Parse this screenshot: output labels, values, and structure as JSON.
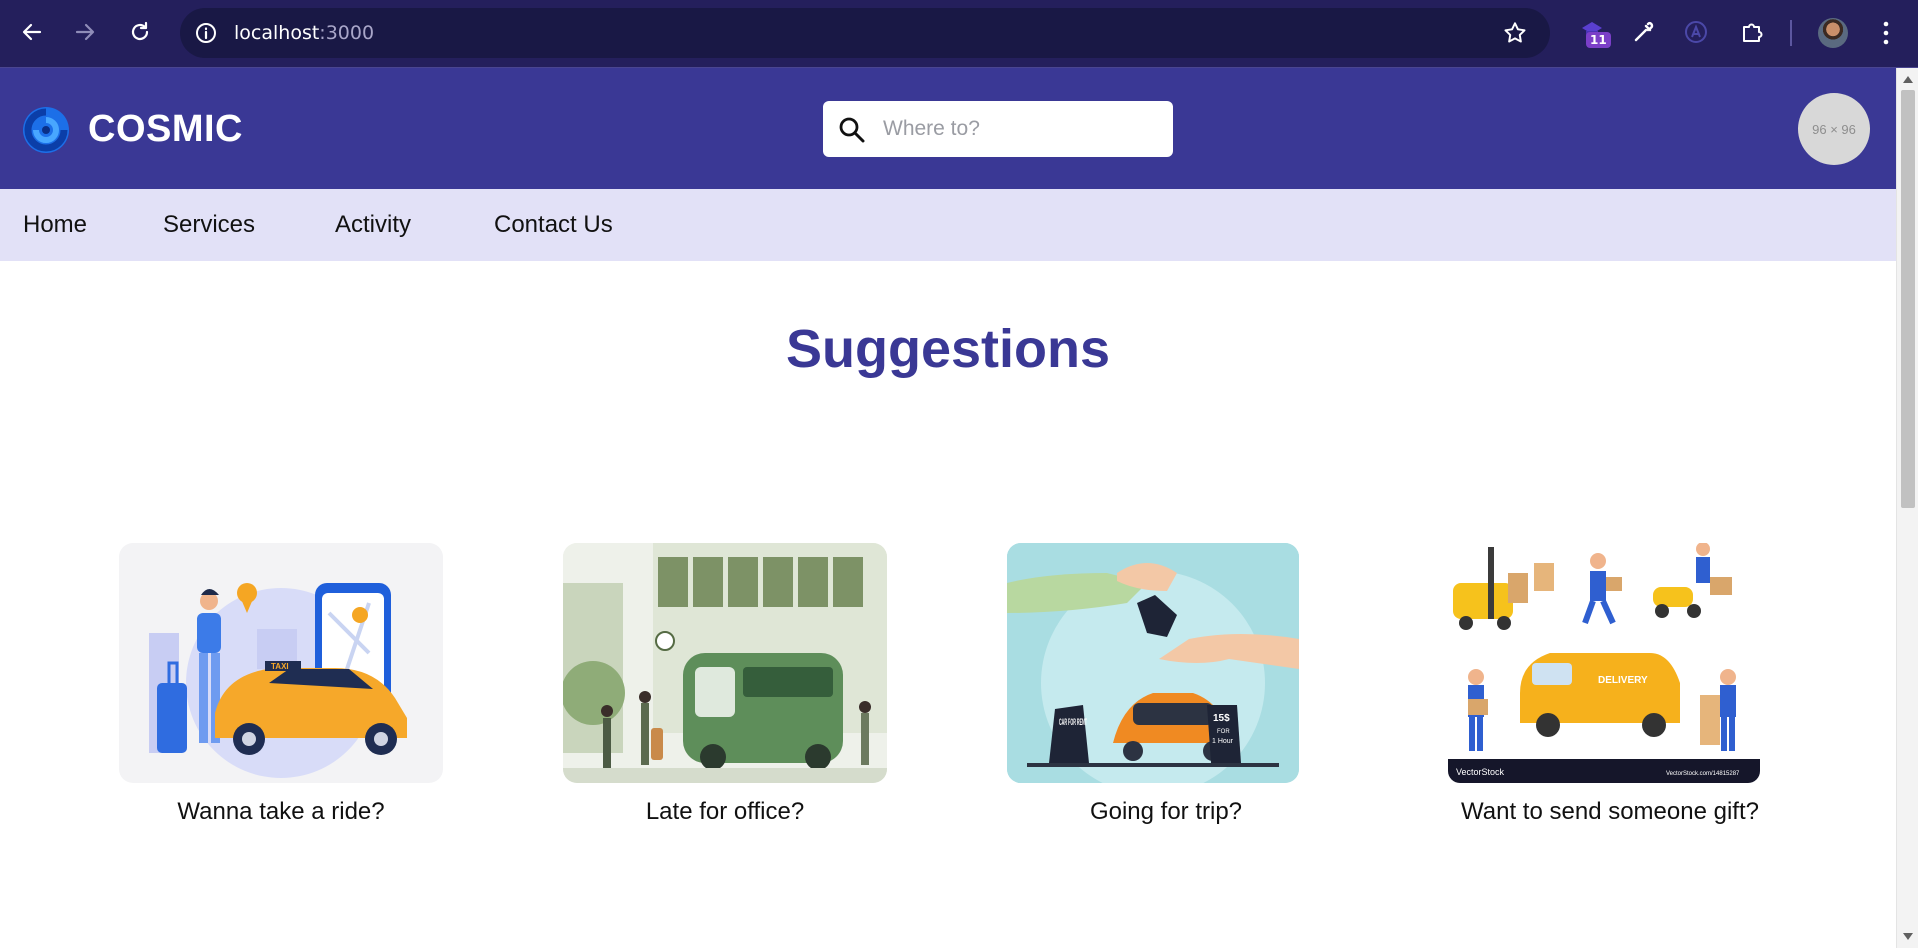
{
  "browser": {
    "url_host": "localhost",
    "url_port": ":3000",
    "extension_badge": "11"
  },
  "header": {
    "logo_text": "COSMIC",
    "search_placeholder": "Where to?",
    "avatar_placeholder": "96 × 96"
  },
  "subnav": {
    "items": [
      {
        "label": "Home"
      },
      {
        "label": "Services"
      },
      {
        "label": "Activity"
      },
      {
        "label": "Contact Us"
      }
    ]
  },
  "main": {
    "title": "Suggestions",
    "cards": [
      {
        "caption": "Wanna take a ride?",
        "image": "taxi-ride-illustration"
      },
      {
        "caption": "Late for office?",
        "image": "bus-station-illustration"
      },
      {
        "caption": "Going for trip?",
        "image": "car-rental-illustration"
      },
      {
        "caption": "Want to send someone gift?",
        "image": "delivery-illustration"
      }
    ],
    "delivery_image_text": "DELIVERY",
    "watermark_left": "VectorStock",
    "watermark_right": "VectorStock.com/14815287",
    "rent_sign_left": "CAR FOR RENT",
    "rent_sign_right_price": "15$",
    "rent_sign_right_for": "FOR",
    "rent_sign_right_duration": "1 Hour",
    "taxi_sign": "TAXI"
  },
  "colors": {
    "chrome_bg": "#241f5c",
    "header_bg": "#3a3895",
    "subnav_bg": "#e2e1f7",
    "title_color": "#3a3895"
  }
}
